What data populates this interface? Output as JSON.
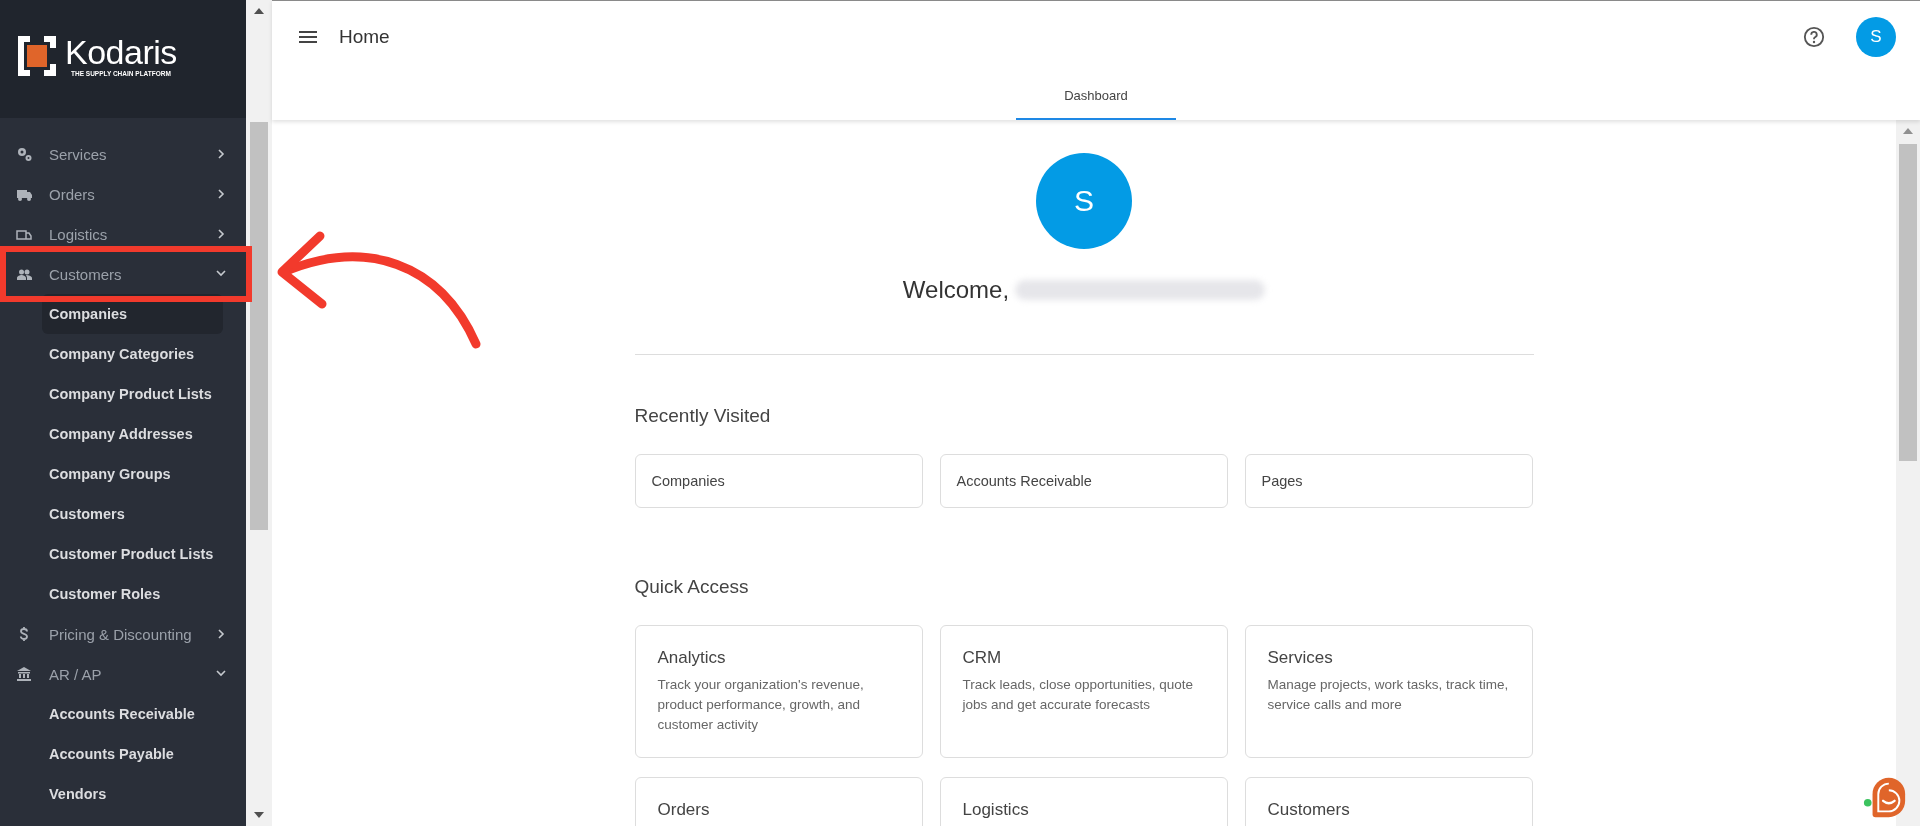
{
  "sidebar": {
    "logo": {
      "name": "Kodaris",
      "tagline": "THE SUPPLY CHAIN PLATFORM"
    },
    "items": [
      {
        "label": "Services",
        "expanded": false
      },
      {
        "label": "Orders",
        "expanded": false
      },
      {
        "label": "Logistics",
        "expanded": false
      },
      {
        "label": "Customers",
        "expanded": true,
        "children": [
          {
            "label": "Companies",
            "selected": true
          },
          {
            "label": "Company Categories",
            "selected": false
          },
          {
            "label": "Company Product Lists",
            "selected": false
          },
          {
            "label": "Company Addresses",
            "selected": false
          },
          {
            "label": "Company Groups",
            "selected": false
          },
          {
            "label": "Customers",
            "selected": false
          },
          {
            "label": "Customer Product Lists",
            "selected": false
          },
          {
            "label": "Customer Roles",
            "selected": false
          }
        ]
      },
      {
        "label": "Pricing & Discounting",
        "expanded": false
      },
      {
        "label": "AR / AP",
        "expanded": true,
        "children": [
          {
            "label": "Accounts Receivable",
            "selected": false
          },
          {
            "label": "Accounts Payable",
            "selected": false
          },
          {
            "label": "Vendors",
            "selected": false
          }
        ]
      }
    ]
  },
  "topbar": {
    "title": "Home",
    "avatar": "S",
    "tabs": [
      {
        "label": "Dashboard",
        "selected": true
      }
    ]
  },
  "dashboard": {
    "avatar": "S",
    "welcome": "Welcome,",
    "recently_visited": {
      "heading": "Recently Visited",
      "items": [
        "Companies",
        "Accounts Receivable",
        "Pages"
      ]
    },
    "quick_access": {
      "heading": "Quick Access",
      "cards": [
        {
          "title": "Analytics",
          "description": "Track your organization's revenue, product performance, growth, and customer activity"
        },
        {
          "title": "CRM",
          "description": "Track leads, close opportunities, quote jobs and get accurate forecasts"
        },
        {
          "title": "Services",
          "description": "Manage projects, work tasks, track time, service calls and more"
        },
        {
          "title": "Orders"
        },
        {
          "title": "Logistics"
        },
        {
          "title": "Customers"
        }
      ]
    }
  }
}
